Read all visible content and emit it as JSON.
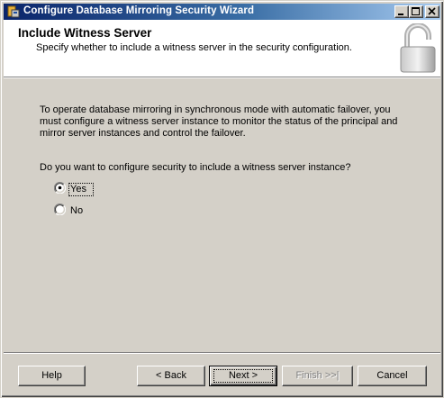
{
  "window": {
    "title": "Configure Database Mirroring Security Wizard"
  },
  "header": {
    "title": "Include Witness Server",
    "subtitle": "Specify whether to include a witness server in the security configuration."
  },
  "content": {
    "description": "To operate database mirroring in synchronous mode with automatic failover, you must configure a witness server instance to monitor the status of the principal and mirror server instances and control the failover.",
    "question": "Do you want to configure security to include a witness server instance?",
    "options": [
      {
        "label": "Yes",
        "selected": true
      },
      {
        "label": "No",
        "selected": false
      }
    ]
  },
  "buttons": {
    "help": "Help",
    "back": "< Back",
    "next": "Next >",
    "finish": "Finish >>|",
    "cancel": "Cancel"
  }
}
